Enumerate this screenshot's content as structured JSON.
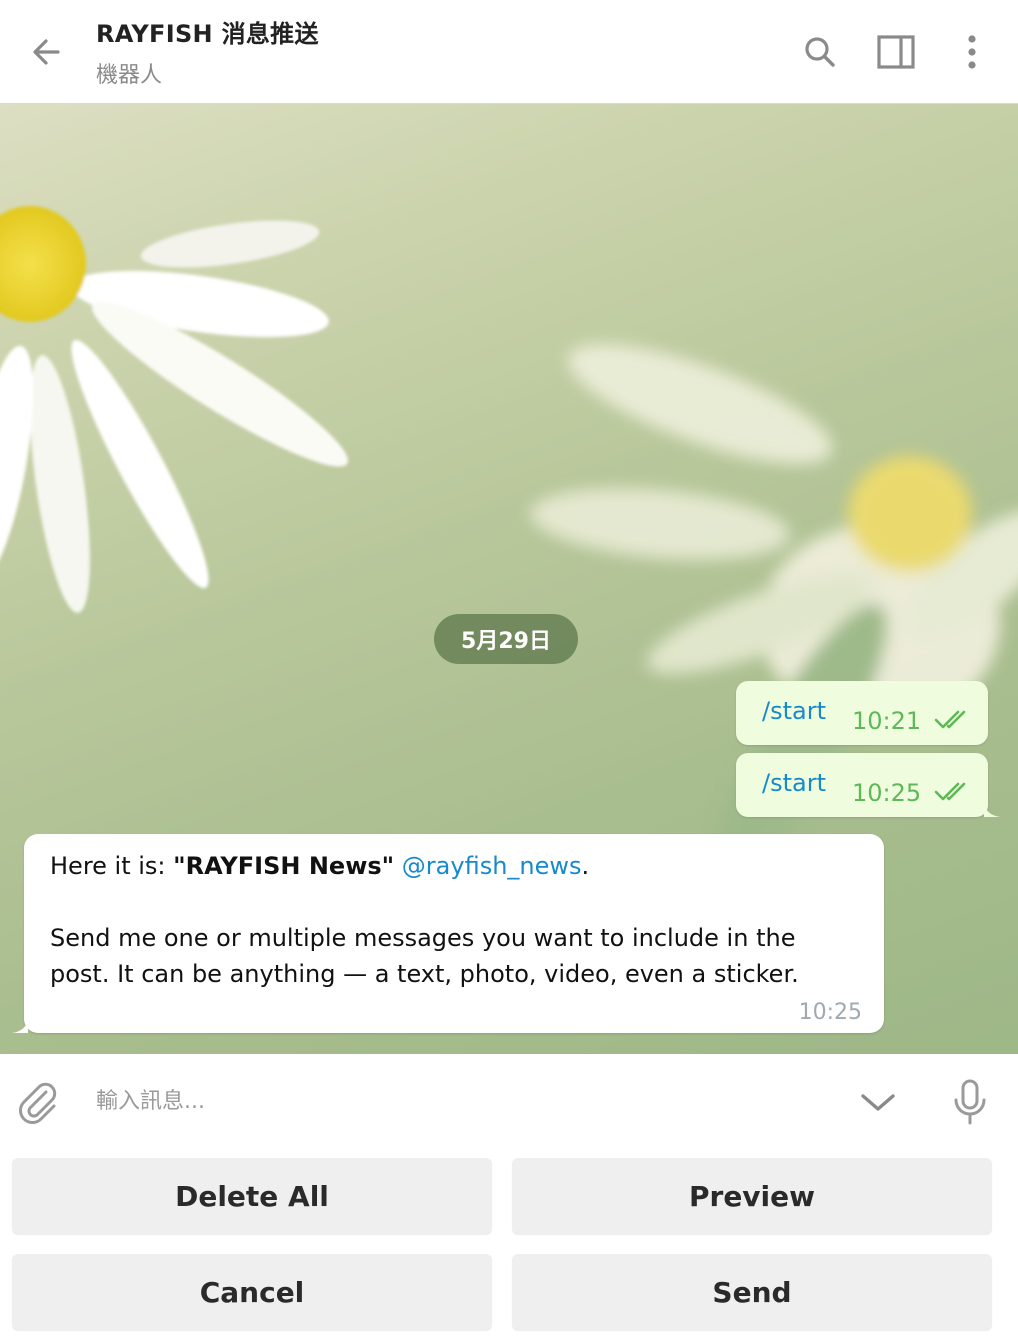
{
  "header": {
    "title": "RAYFISH 消息推送",
    "subtitle": "機器人",
    "icons": [
      "back-arrow-icon",
      "search-icon",
      "sidebar-toggle-icon",
      "more-vertical-icon"
    ]
  },
  "chat": {
    "date_label": "5月29日",
    "outgoing": [
      {
        "text": "/start",
        "time": "10:21",
        "status": "read"
      },
      {
        "text": "/start",
        "time": "10:25",
        "status": "read"
      }
    ],
    "incoming": {
      "intro": "Here it is: ",
      "bold": "\"RAYFISH News\"",
      "space": " ",
      "mention": "@rayfish_news",
      "period": ".",
      "paragraph": "Send me one or multiple messages you want to include in the post. It can be anything — a text, photo, video, even a sticker.",
      "time": "10:25"
    },
    "colors": {
      "link": "#168acd",
      "out_bubble": "#effdde",
      "out_time": "#5fb858"
    }
  },
  "composer": {
    "placeholder": "輸入訊息...",
    "value": ""
  },
  "keyboard": {
    "buttons": [
      "Delete All",
      "Preview",
      "Cancel",
      "Send"
    ]
  }
}
